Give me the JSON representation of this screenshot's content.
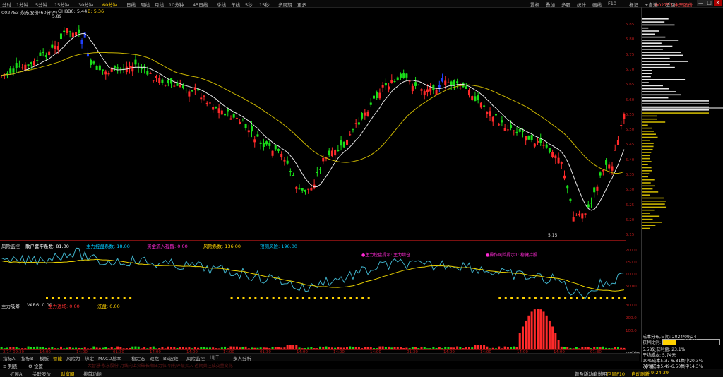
{
  "top_tabs": [
    "分时",
    "1分钟",
    "5分钟",
    "15分钟",
    "30分钟",
    "60分钟",
    "日线",
    "周线",
    "月线",
    "10分钟",
    "45日线",
    "季线",
    "年线",
    "5秒",
    "15秒",
    "多周期",
    "更多"
  ],
  "active_tab": "60分钟",
  "top_right": [
    "置权",
    "叠加",
    "多股",
    "统计",
    "画线",
    "F10",
    "标记",
    "+自选",
    "返回"
  ],
  "stock_title": "002753 永东股份",
  "window_controls": [
    "—",
    "□",
    "✕"
  ],
  "main_panel": {
    "title": "002753 永东股份(60分钟)",
    "indicator": "GHB",
    "b0": "B0: 5.44",
    "b": "B: 5.36",
    "high_label": "5.89",
    "low_label": "5.15",
    "price_axis": [
      "5.85",
      "5.80",
      "5.75",
      "5.70",
      "5.65",
      "5.60",
      "5.55",
      "5.50",
      "5.45",
      "5.40",
      "5.35",
      "5.30",
      "5.25",
      "5.20",
      "5.15"
    ]
  },
  "risk_panel": {
    "title": "风险监控",
    "items": [
      {
        "label": "散户套牢系数: 81.00",
        "color": "#ffffff"
      },
      {
        "label": "主力控盘系数: 18.00",
        "color": "#00c8ff"
      },
      {
        "label": "资金流入提醒: 0.00",
        "color": "#ff2ad4"
      },
      {
        "label": "风险系数: 136.00",
        "color": "#ffd200"
      },
      {
        "label": "预测风险: 196.00",
        "color": "#00c8ff"
      }
    ],
    "annotation1": "●主力控盘提示: 主力增仓",
    "annotation2": "●操作风险提示1: 稳健持股",
    "axis": [
      "200.0",
      "150.0",
      "100.0",
      "50.00"
    ]
  },
  "volume_panel": {
    "title": "主力吸筹",
    "var6": "VAR6: 0.00",
    "items": [
      {
        "label": "主力进场: 0.00",
        "color": "#ff3030"
      },
      {
        "label": "洗盘: 0.00",
        "color": "#ffd200"
      }
    ],
    "axis": [
      "300.0",
      "200.0",
      "100.0"
    ]
  },
  "time_axis": [
    "2/14 09:30",
    "14:00",
    "14:00",
    "01:30",
    "14:00",
    "14:00",
    "14:00",
    "01:30",
    "14:00",
    "14:00",
    "14:00",
    "01:30",
    "14:00",
    "14:00",
    "14:00",
    "14:00",
    "01:30"
  ],
  "period_label": "60分钟",
  "bottom_tabs": [
    "指标A",
    "指标B",
    "模板",
    "智能",
    "风险为",
    "绑定",
    "MACD基本",
    "稳定态",
    "双龙",
    "BS波段",
    "风险监控",
    "HJJT",
    "多人分析"
  ],
  "active_bottom_tab": "智能",
  "message_text": "大智慧·永东股份 月线向上突破长期压力位·机构评级买入 近期关注成交量变化",
  "toolbar": [
    "列表",
    "设置"
  ],
  "status_left": [
    "扩展A",
    "关联股价",
    "财富圈",
    "排首功能"
  ],
  "status_right": [
    "普及版功能说明",
    "回顾F10",
    "自动刷新",
    "9:24:39"
  ],
  "cost_panel": {
    "date_label": "成本分布,日期: 2024/09/24",
    "profit_label": "获利比例:",
    "profit_value": "23.1%",
    "profit_fill": 0.231,
    "rows": [
      "5.58处获利盘: 23.1%",
      "平均成本: 5.74元",
      "90%成本5.37-6.81集中20.3%",
      "70%成本5.49-6.50集中14.3%"
    ],
    "send_label": "发送"
  },
  "colors": {
    "up": "#ff2a2a",
    "down": "#19e019",
    "ma1": "#e6e6e6",
    "ma2": "#c9b400",
    "bg": "#000000"
  }
}
